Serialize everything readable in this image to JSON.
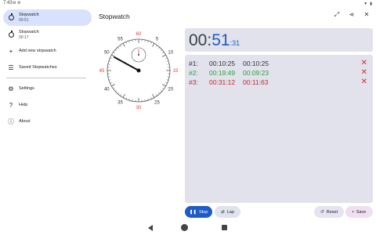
{
  "status_bar": {
    "time": "7:43",
    "notif_icons": "⚙ ⚙",
    "wifi": "▼",
    "battery": "▮"
  },
  "sidebar": {
    "items": [
      {
        "label": "Stopwatch",
        "sub": "00:51",
        "icon": "stopwatch-icon",
        "active": true
      },
      {
        "label": "Stopwatch",
        "sub": "00:17",
        "icon": "stopwatch-icon",
        "active": false
      },
      {
        "label": "Add new stopwatch",
        "icon": "plus-icon"
      },
      {
        "label": "Saved Stopwatches",
        "icon": "list-icon"
      },
      {
        "label": "Settings",
        "icon": "gear-icon"
      },
      {
        "label": "Help",
        "icon": "help-icon"
      },
      {
        "label": "About",
        "icon": "info-icon"
      }
    ]
  },
  "header": {
    "title": "Stopwatch",
    "actions": [
      "Fullscreen",
      "Share",
      "Close"
    ]
  },
  "dial": {
    "numbers": [
      "60",
      "5",
      "10",
      "15",
      "20",
      "25",
      "30",
      "35",
      "40",
      "45",
      "50",
      "55"
    ],
    "accent_color": "#e53935"
  },
  "timer": {
    "minutes": "00",
    "seconds": "51",
    "centis": "31"
  },
  "laps": [
    {
      "num": "#1:",
      "split": "00:10:25",
      "total": "00:10:25",
      "kind": "plain"
    },
    {
      "num": "#2:",
      "split": "00:19:49",
      "total": "00:09:23",
      "kind": "best"
    },
    {
      "num": "#3:",
      "split": "00:31:12",
      "total": "00:11:63",
      "kind": "worst"
    }
  ],
  "buttons": {
    "stop": "Stop",
    "lap": "Lap",
    "reset": "Reset",
    "save": "Save"
  },
  "colors": {
    "primary": "#1e5bc6",
    "best": "#2e9e3a",
    "worst": "#c62828",
    "panel": "#e1e2ec"
  }
}
